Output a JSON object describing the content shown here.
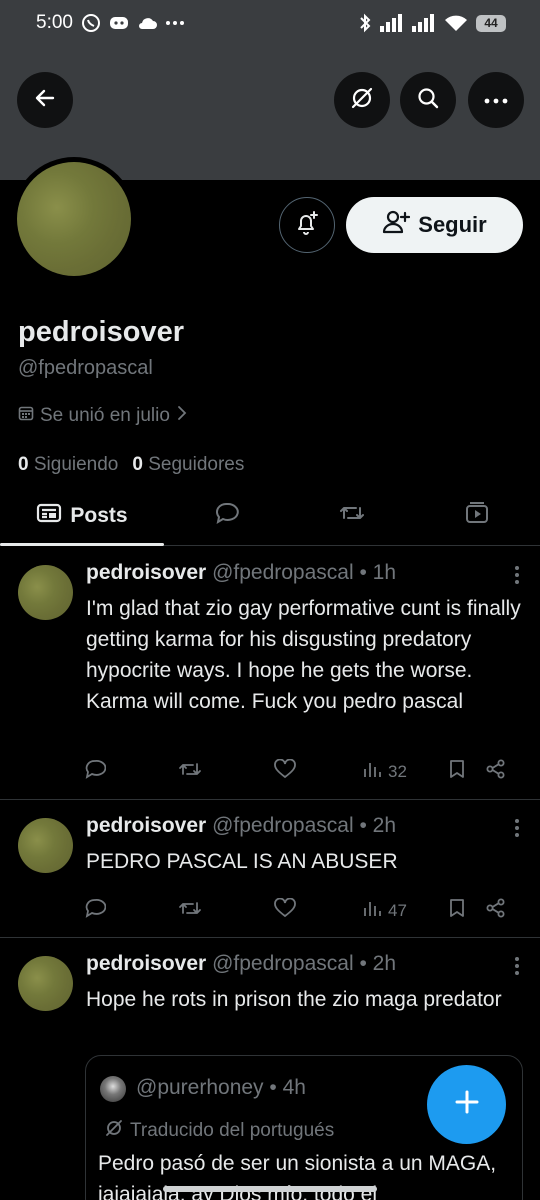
{
  "status_bar": {
    "time": "5:00",
    "battery": "44"
  },
  "profile": {
    "display_name": "pedroisover",
    "handle": "@fpedropascal",
    "joined": "Se unió en julio",
    "following_count": "0",
    "following_label": "Siguiendo",
    "followers_count": "0",
    "followers_label": "Seguidores",
    "follow_button": "Seguir"
  },
  "tabs": {
    "posts": "Posts"
  },
  "posts": [
    {
      "name": "pedroisover",
      "meta": "@fpedropascal • 1h",
      "text": "I'm glad that zio gay performative cunt is finally getting karma for his disgusting predatory hypocrite ways. I hope he gets the worse. Karma will come. Fuck you pedro pascal",
      "views": "32"
    },
    {
      "name": "pedroisover",
      "meta": "@fpedropascal • 2h",
      "text": "PEDRO PASCAL IS AN ABUSER",
      "views": "47"
    },
    {
      "name": "pedroisover",
      "meta": "@fpedropascal • 2h",
      "text": "Hope he rots in prison the zio maga predator",
      "quote": {
        "handle": "@purerhoney • 4h",
        "translated": "Traducido del portugués",
        "text": "Pedro pasó de ser un sionista a un MAGA, jajajajaja, ay Dios mío, todo el"
      }
    }
  ],
  "colors": {
    "accent": "#1d9bf0",
    "banner": "#3a3d40",
    "muted": "#71767b"
  }
}
